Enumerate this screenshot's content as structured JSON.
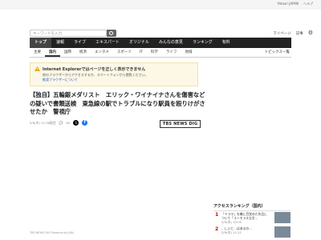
{
  "top_links": [
    "Yahoo! JAPAN",
    "ヘルプ"
  ],
  "search": {
    "placeholder": "キーワードを入力"
  },
  "header_right": {
    "mypage_label": "マイページ",
    "news_label": "記事",
    "gear_icon": "gear-icon"
  },
  "main_nav": [
    "トップ",
    "速報",
    "ライブ",
    "エキスパート",
    "オリジナル",
    "みんなの意見",
    "ランキング",
    "有料"
  ],
  "sub_nav": [
    "主要",
    "国内",
    "国際",
    "経済",
    "エンタメ",
    "スポーツ",
    "IT",
    "科学",
    "ライフ",
    "地域"
  ],
  "sub_nav_active": "国内",
  "sub_nav_topics": "トピックス一覧",
  "notice": {
    "icon": "warning-icon",
    "title": "Internet Explorerではページを正しく表示できません",
    "body": "他のブラウザーからアクセスするか、スマートフォンから閲覧ください。",
    "link": "推奨ブラウザーについて"
  },
  "article": {
    "headline": "【独自】五輪銀メダリスト　エリック・ワイナイナさんを傷害などの疑いで書類送検　東急線の駅でトラブルになり駅員を殴りけがさせたか　警視庁",
    "date": "5/9(木) 11:36配信",
    "comment_count": "62",
    "source_logo": "TBS NEWS DIG",
    "credit": "TBS NEWS DIG Powered by JNN"
  },
  "ranking": {
    "title": "アクセスランキング（国内）",
    "items": [
      {
        "rank": "1",
        "text": "「ドラマ」を機に目覚めた作品について「ユーモラスな言…",
        "meta": "5/9(木) 10:05"
      },
      {
        "rank": "2",
        "text": "…しいと…はあるの…",
        "meta": "5/9(木) 11:21"
      }
    ]
  }
}
